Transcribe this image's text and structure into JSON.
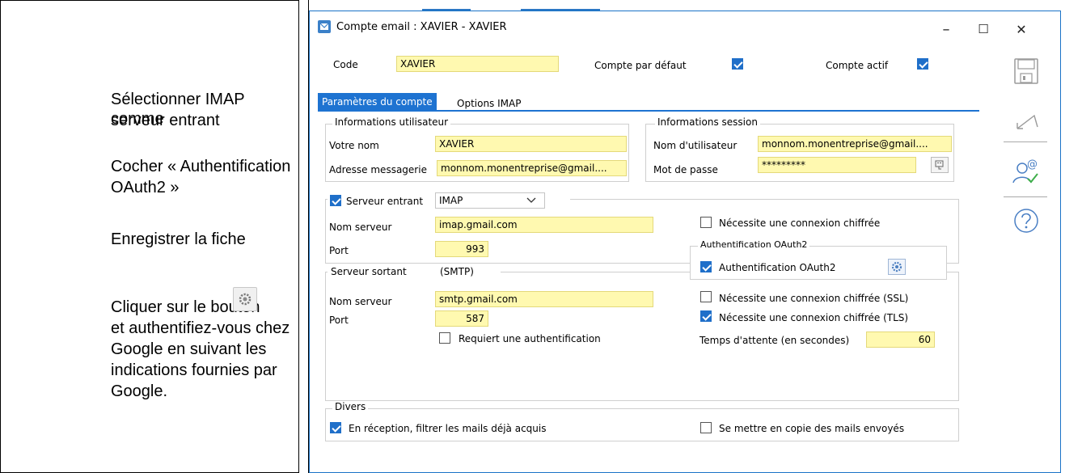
{
  "instructions": {
    "line1": "Sélectionner IMAP comme",
    "line2": "serveur entrant",
    "line3": "Cocher « Authentification",
    "line4": "OAuth2 »",
    "line5": "Enregistrer la fiche",
    "line6": "Cliquer sur le bouton",
    "line7": "et authentifiez-vous chez",
    "line8": "Google en suivant les",
    "line9": "indications fournies par",
    "line10": "Google."
  },
  "window": {
    "title": "Compte email : XAVIER - XAVIER",
    "minimize": "–",
    "maximize": "☐",
    "close": "✕"
  },
  "header": {
    "code_label": "Code",
    "code_value": "XAVIER",
    "default_label": "Compte par défaut",
    "active_label": "Compte actif"
  },
  "tabs": [
    {
      "label": "Paramètres du compte"
    },
    {
      "label": "Options IMAP"
    }
  ],
  "user_info": {
    "title": "Informations utilisateur",
    "name_label": "Votre nom",
    "name_value": "XAVIER",
    "email_label": "Adresse messagerie",
    "email_value": "monnom.monentreprise@gmail...."
  },
  "session_info": {
    "title": "Informations session",
    "user_label": "Nom d'utilisateur",
    "user_value": "monnom.monentreprise@gmail....",
    "pass_label": "Mot de passe",
    "pass_value": "*********"
  },
  "incoming": {
    "title": "Serveur entrant",
    "protocol": "IMAP",
    "server_label": "Nom serveur",
    "server_value": "imap.gmail.com",
    "port_label": "Port",
    "port_value": "993",
    "encrypted_label": "Nécessite une connexion chiffrée"
  },
  "oauth": {
    "title": "Authentification OAuth2",
    "check_label": "Authentification OAuth2"
  },
  "outgoing": {
    "title": "Serveur sortant",
    "subtitle": "(SMTP)",
    "server_label": "Nom serveur",
    "server_value": "smtp.gmail.com",
    "port_label": "Port",
    "port_value": "587",
    "auth_label": "Requiert une authentification",
    "ssl_label": "Nécessite une connexion chiffrée (SSL)",
    "tls_label": "Nécessite une connexion chiffrée (TLS)",
    "timeout_label": "Temps d'attente (en secondes)",
    "timeout_value": "60"
  },
  "misc": {
    "title": "Divers",
    "filter_label": "En réception, filtrer les mails déjà acquis",
    "copy_label": "Se mettre en copie des mails envoyés"
  }
}
